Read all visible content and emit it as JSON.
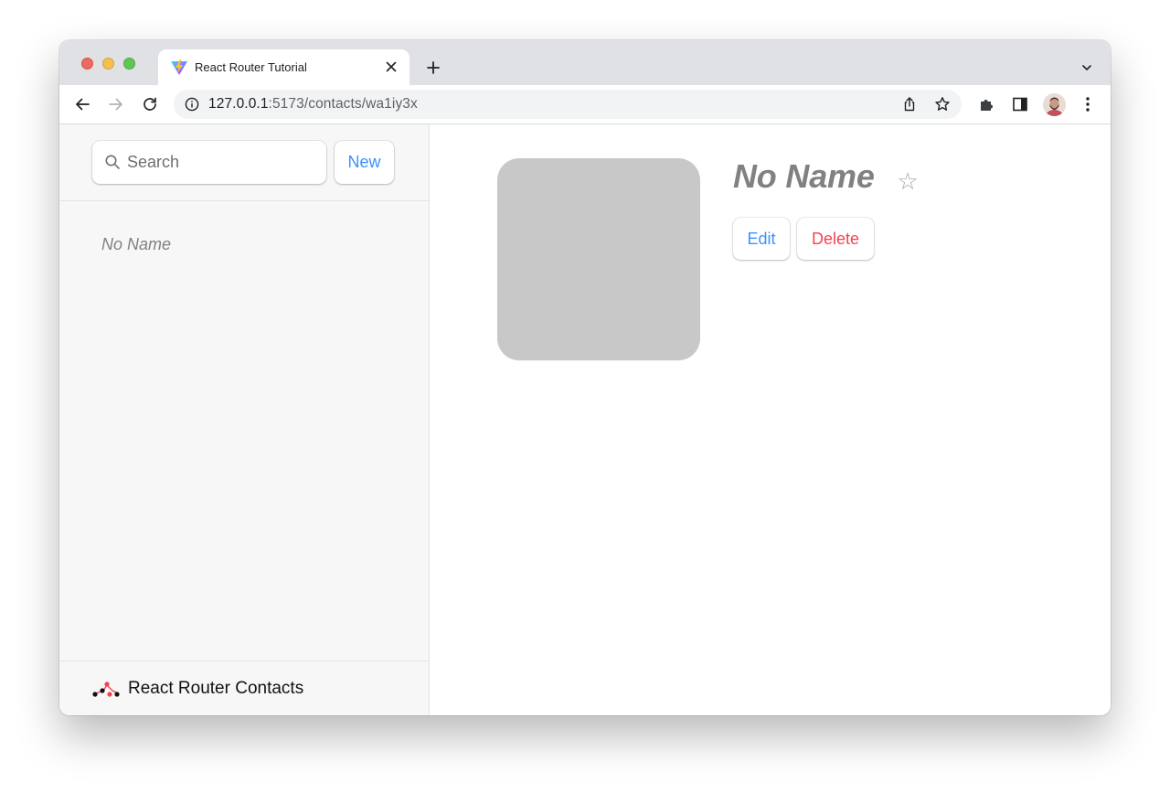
{
  "browser": {
    "tab_title": "React Router Tutorial",
    "url_host": "127.0.0.1",
    "url_rest": ":5173/contacts/wa1iy3x"
  },
  "sidebar": {
    "search_placeholder": "Search",
    "new_button": "New",
    "contacts": [
      {
        "name": "No Name"
      }
    ],
    "footer_title": "React Router Contacts"
  },
  "detail": {
    "name": "No Name",
    "favorite_glyph": "☆",
    "edit_button": "Edit",
    "delete_button": "Delete"
  },
  "colors": {
    "accent_blue": "#3992ff",
    "danger_red": "#f44250",
    "avatar_placeholder": "#c8c8c8",
    "muted_text": "#818181"
  }
}
